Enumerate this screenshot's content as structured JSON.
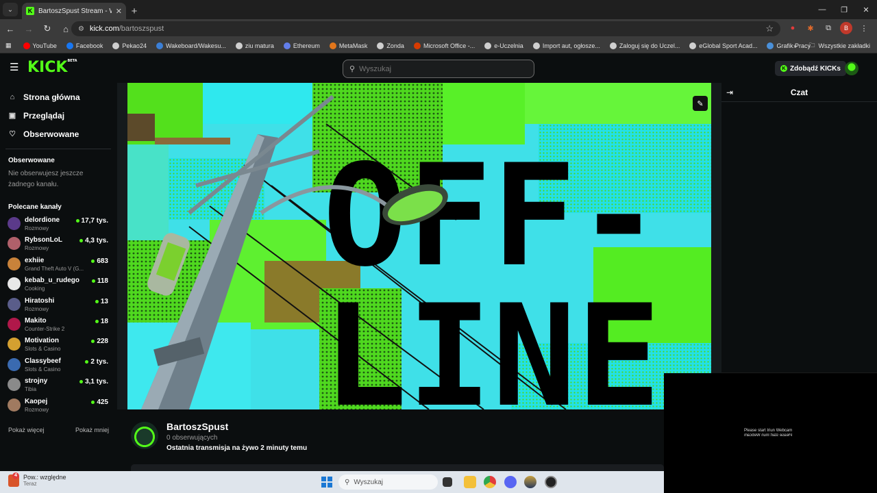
{
  "browser": {
    "tab_title": "BartoszSpust Stream - Watch L",
    "url_host": "kick.com",
    "url_path": "/bartoszspust",
    "bookmarks": [
      {
        "label": "YouTube",
        "color": "#ff0000"
      },
      {
        "label": "Facebook",
        "color": "#1877f2"
      },
      {
        "label": "Pekao24",
        "color": "#cfcfcf"
      },
      {
        "label": "Wakeboard/Wakesu...",
        "color": "#3b7fd6"
      },
      {
        "label": "ziu matura",
        "color": "#cfcfcf"
      },
      {
        "label": "Ethereum",
        "color": "#627eea"
      },
      {
        "label": "MetaMask",
        "color": "#e2761b"
      },
      {
        "label": "Zonda",
        "color": "#cfcfcf"
      },
      {
        "label": "Microsoft Office -...",
        "color": "#d83b01"
      },
      {
        "label": "e-Uczelnia",
        "color": "#cfcfcf"
      },
      {
        "label": "Import aut, ogłosze...",
        "color": "#cfcfcf"
      },
      {
        "label": "Zaloguj się do Uczel...",
        "color": "#cfcfcf"
      },
      {
        "label": "eGlobal Sport Acad...",
        "color": "#cfcfcf"
      },
      {
        "label": "Grafik Pracy",
        "color": "#4a90d9"
      }
    ],
    "all_bookmarks": "Wszystkie zakładki",
    "profile_initial": "B"
  },
  "header": {
    "logo": "KICK",
    "logo_badge": "BETA",
    "search_placeholder": "Wyszukaj",
    "get_kicks": "Zdobądź KICKs"
  },
  "sidebar": {
    "nav": [
      {
        "label": "Strona główna",
        "icon": "home-icon"
      },
      {
        "label": "Przeglądaj",
        "icon": "browse-icon"
      },
      {
        "label": "Obserwowane",
        "icon": "heart-icon"
      }
    ],
    "following_title": "Obserwowane",
    "following_empty": "Nie obserwujesz jeszcze żadnego kanału.",
    "recommended_title": "Polecane kanały",
    "channels": [
      {
        "name": "delordione",
        "category": "Rozmowy",
        "viewers": "17,7 tys.",
        "avatar": "#5b3a8a"
      },
      {
        "name": "RybsonLoL",
        "category": "Rozmowy",
        "viewers": "4,3 tys.",
        "avatar": "#b0606a"
      },
      {
        "name": "exhiie",
        "category": "Grand Theft Auto V (G...",
        "viewers": "683",
        "avatar": "#c8823a"
      },
      {
        "name": "kebab_u_rudego",
        "category": "Cooking",
        "viewers": "118",
        "avatar": "#e8e8e8"
      },
      {
        "name": "Hiratoshi",
        "category": "Rozmowy",
        "viewers": "13",
        "avatar": "#5a5d8a"
      },
      {
        "name": "Makito",
        "category": "Counter-Strike 2",
        "viewers": "18",
        "avatar": "#b0184a"
      },
      {
        "name": "Motivation",
        "category": "Slots & Casino",
        "viewers": "228",
        "avatar": "#d4a030"
      },
      {
        "name": "Classybeef",
        "category": "Slots & Casino",
        "viewers": "2 tys.",
        "avatar": "#3a6ab0"
      },
      {
        "name": "strojny",
        "category": "Tibia",
        "viewers": "3,1 tys.",
        "avatar": "#8a8a8a"
      },
      {
        "name": "Kaopej",
        "category": "Rozmowy",
        "viewers": "425",
        "avatar": "#a07a60"
      }
    ],
    "show_more": "Pokaż więcej",
    "show_less": "Pokaż mniej"
  },
  "chat": {
    "title": "Czat"
  },
  "webcam": {
    "message": "Please start Iriun Webcam"
  },
  "channel": {
    "name": "BartoszSpust",
    "followers": "0 obserwujących",
    "last_stream": "Ostatnia transmisja na żywo 2 minuty temu"
  },
  "taskbar": {
    "notif_title": "Pow.: względne",
    "notif_sub": "Teraz",
    "notif_badge": "4",
    "search_placeholder": "Wyszukaj"
  },
  "colors": {
    "kick_green": "#53fc18",
    "background": "#0b0e0f"
  }
}
